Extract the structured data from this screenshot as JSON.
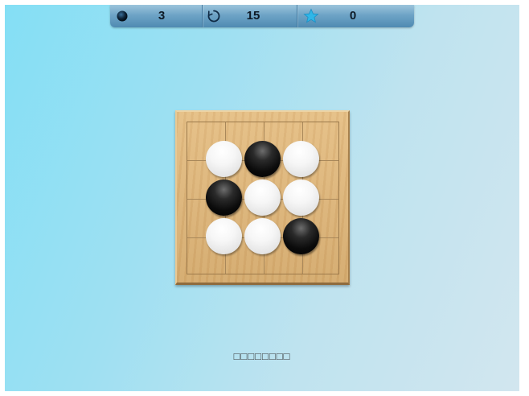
{
  "hud": {
    "stones": {
      "icon": "black-stone-icon",
      "value": "3"
    },
    "moves": {
      "icon": "restart-icon",
      "value": "15"
    },
    "stars": {
      "icon": "star-icon",
      "value": "0"
    }
  },
  "board": {
    "size": 3,
    "cells": [
      [
        "white",
        "black",
        "white"
      ],
      [
        "black",
        "white",
        "white"
      ],
      [
        "white",
        "white",
        "black"
      ]
    ]
  },
  "status_text": "□□□□□□□□",
  "colors": {
    "background": "#84dff5",
    "hud": "#6ea4c6",
    "board_wood": "#dcb47a",
    "star": "#2fb6e8"
  }
}
